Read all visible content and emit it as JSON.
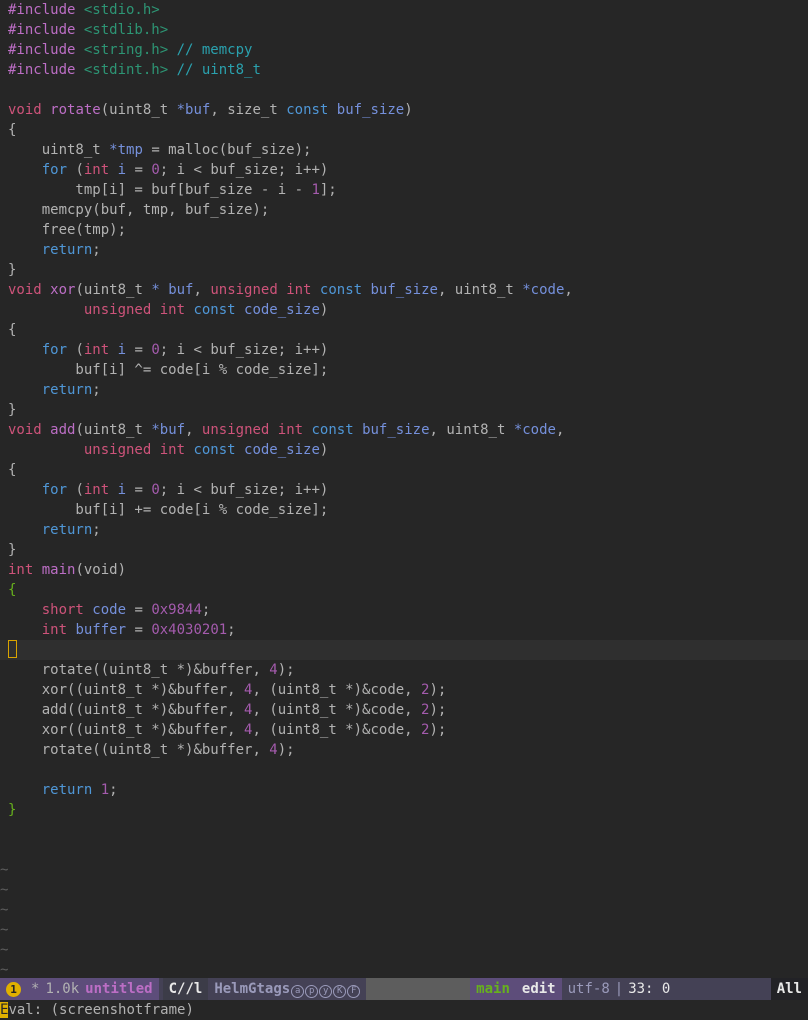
{
  "editor": {
    "code_lines": [
      [
        [
          "#include ",
          "pp"
        ],
        [
          "<stdio.h>",
          "hdr"
        ]
      ],
      [
        [
          "#include ",
          "pp"
        ],
        [
          "<stdlib.h>",
          "hdr"
        ]
      ],
      [
        [
          "#include ",
          "pp"
        ],
        [
          "<string.h>",
          "hdr"
        ],
        [
          " // memcpy",
          "cm"
        ]
      ],
      [
        [
          "#include ",
          "pp"
        ],
        [
          "<stdint.h>",
          "hdr"
        ],
        [
          " // uint8_t",
          "cm"
        ]
      ],
      [],
      [
        [
          "void ",
          "ty"
        ],
        [
          "rotate",
          "fn"
        ],
        [
          "(",
          "pl"
        ],
        [
          "uint8_t ",
          "pl"
        ],
        [
          "*",
          "ptr"
        ],
        [
          "buf",
          "var"
        ],
        [
          ", ",
          "pl"
        ],
        [
          "size_t ",
          "pl"
        ],
        [
          "const ",
          "kw"
        ],
        [
          "buf_size",
          "var"
        ],
        [
          ")",
          "pl"
        ]
      ],
      [
        [
          "{",
          "pl"
        ]
      ],
      [
        [
          "    uint8_t ",
          "pl"
        ],
        [
          "*",
          "ptr"
        ],
        [
          "tmp",
          "var"
        ],
        [
          " = malloc(buf_size);",
          "pl"
        ]
      ],
      [
        [
          "    ",
          "pl"
        ],
        [
          "for",
          "kw"
        ],
        [
          " (",
          "pl"
        ],
        [
          "int ",
          "ty"
        ],
        [
          "i",
          "var"
        ],
        [
          " = ",
          "pl"
        ],
        [
          "0",
          "num"
        ],
        [
          "; i < buf_size; i++)",
          "pl"
        ]
      ],
      [
        [
          "        tmp[i] = buf[buf_size - i - ",
          "pl"
        ],
        [
          "1",
          "num"
        ],
        [
          "];",
          "pl"
        ]
      ],
      [
        [
          "    memcpy(buf, tmp, buf_size);",
          "pl"
        ]
      ],
      [
        [
          "    free(tmp);",
          "pl"
        ]
      ],
      [
        [
          "    ",
          "pl"
        ],
        [
          "return",
          "kw"
        ],
        [
          ";",
          "pl"
        ]
      ],
      [
        [
          "}",
          "pl"
        ]
      ],
      [
        [
          "void ",
          "ty"
        ],
        [
          "xor",
          "fn"
        ],
        [
          "(",
          "pl"
        ],
        [
          "uint8_t ",
          "pl"
        ],
        [
          "* ",
          "ptr"
        ],
        [
          "buf",
          "var"
        ],
        [
          ", ",
          "pl"
        ],
        [
          "unsigned int ",
          "ty"
        ],
        [
          "const ",
          "kw"
        ],
        [
          "buf_size",
          "var"
        ],
        [
          ", uint8_t ",
          "pl"
        ],
        [
          "*",
          "ptr"
        ],
        [
          "code",
          "var"
        ],
        [
          ",",
          "pl"
        ]
      ],
      [
        [
          "         ",
          "pl"
        ],
        [
          "unsigned int ",
          "ty"
        ],
        [
          "const ",
          "kw"
        ],
        [
          "code_size",
          "var"
        ],
        [
          ")",
          "pl"
        ]
      ],
      [
        [
          "{",
          "pl"
        ]
      ],
      [
        [
          "    ",
          "pl"
        ],
        [
          "for",
          "kw"
        ],
        [
          " (",
          "pl"
        ],
        [
          "int ",
          "ty"
        ],
        [
          "i",
          "var"
        ],
        [
          " = ",
          "pl"
        ],
        [
          "0",
          "num"
        ],
        [
          "; i < buf_size; i++)",
          "pl"
        ]
      ],
      [
        [
          "        buf[i] ^= code[i % code_size];",
          "pl"
        ]
      ],
      [
        [
          "    ",
          "pl"
        ],
        [
          "return",
          "kw"
        ],
        [
          ";",
          "pl"
        ]
      ],
      [
        [
          "}",
          "pl"
        ]
      ],
      [
        [
          "void ",
          "ty"
        ],
        [
          "add",
          "fn"
        ],
        [
          "(",
          "pl"
        ],
        [
          "uint8_t ",
          "pl"
        ],
        [
          "*",
          "ptr"
        ],
        [
          "buf",
          "var"
        ],
        [
          ", ",
          "pl"
        ],
        [
          "unsigned int ",
          "ty"
        ],
        [
          "const ",
          "kw"
        ],
        [
          "buf_size",
          "var"
        ],
        [
          ", uint8_t ",
          "pl"
        ],
        [
          "*",
          "ptr"
        ],
        [
          "code",
          "var"
        ],
        [
          ",",
          "pl"
        ]
      ],
      [
        [
          "         ",
          "pl"
        ],
        [
          "unsigned int ",
          "ty"
        ],
        [
          "const ",
          "kw"
        ],
        [
          "code_size",
          "var"
        ],
        [
          ")",
          "pl"
        ]
      ],
      [
        [
          "{",
          "pl"
        ]
      ],
      [
        [
          "    ",
          "pl"
        ],
        [
          "for",
          "kw"
        ],
        [
          " (",
          "pl"
        ],
        [
          "int ",
          "ty"
        ],
        [
          "i",
          "var"
        ],
        [
          " = ",
          "pl"
        ],
        [
          "0",
          "num"
        ],
        [
          "; i < buf_size; i++)",
          "pl"
        ]
      ],
      [
        [
          "        buf[i] += code[i % code_size];",
          "pl"
        ]
      ],
      [
        [
          "    ",
          "pl"
        ],
        [
          "return",
          "kw"
        ],
        [
          ";",
          "pl"
        ]
      ],
      [
        [
          "}",
          "pl"
        ]
      ],
      [
        [
          "int ",
          "ty"
        ],
        [
          "main",
          "fn"
        ],
        [
          "(void)",
          "pl"
        ]
      ],
      [
        [
          "{",
          "brace-g"
        ]
      ],
      [
        [
          "    ",
          "pl"
        ],
        [
          "short ",
          "ty"
        ],
        [
          "code",
          "var"
        ],
        [
          " = ",
          "pl"
        ],
        [
          "0x9844",
          "num"
        ],
        [
          ";",
          "pl"
        ]
      ],
      [
        [
          "    ",
          "pl"
        ],
        [
          "int ",
          "ty"
        ],
        [
          "buffer",
          "var"
        ],
        [
          " = ",
          "pl"
        ],
        [
          "0x4030201",
          "num"
        ],
        [
          ";",
          "pl"
        ]
      ],
      [
        "CURSOR"
      ],
      [
        [
          "    rotate(",
          "pl"
        ],
        [
          "(uint8_t *)",
          "pl"
        ],
        [
          "&buffer, ",
          "pl"
        ],
        [
          "4",
          "num"
        ],
        [
          ");",
          "pl"
        ]
      ],
      [
        [
          "    xor(",
          "pl"
        ],
        [
          "(uint8_t *)",
          "pl"
        ],
        [
          "&buffer, ",
          "pl"
        ],
        [
          "4",
          "num"
        ],
        [
          ", ",
          "pl"
        ],
        [
          "(uint8_t *)",
          "pl"
        ],
        [
          "&code, ",
          "pl"
        ],
        [
          "2",
          "num"
        ],
        [
          ");",
          "pl"
        ]
      ],
      [
        [
          "    add(",
          "pl"
        ],
        [
          "(uint8_t *)",
          "pl"
        ],
        [
          "&buffer, ",
          "pl"
        ],
        [
          "4",
          "num"
        ],
        [
          ", ",
          "pl"
        ],
        [
          "(uint8_t *)",
          "pl"
        ],
        [
          "&code, ",
          "pl"
        ],
        [
          "2",
          "num"
        ],
        [
          ");",
          "pl"
        ]
      ],
      [
        [
          "    xor(",
          "pl"
        ],
        [
          "(uint8_t *)",
          "pl"
        ],
        [
          "&buffer, ",
          "pl"
        ],
        [
          "4",
          "num"
        ],
        [
          ", ",
          "pl"
        ],
        [
          "(uint8_t *)",
          "pl"
        ],
        [
          "&code, ",
          "pl"
        ],
        [
          "2",
          "num"
        ],
        [
          ");",
          "pl"
        ]
      ],
      [
        [
          "    rotate(",
          "pl"
        ],
        [
          "(uint8_t *)",
          "pl"
        ],
        [
          "&buffer, ",
          "pl"
        ],
        [
          "4",
          "num"
        ],
        [
          ");",
          "pl"
        ]
      ],
      [],
      [
        [
          "    ",
          "pl"
        ],
        [
          "return ",
          "kw"
        ],
        [
          "1",
          "num"
        ],
        [
          ";",
          "pl"
        ]
      ],
      [
        [
          "}",
          "brace-g"
        ]
      ]
    ],
    "empty_line_marker": "~",
    "empty_line_count": 6,
    "current_line_index": 32
  },
  "modeline": {
    "window_number": "1",
    "modified_flag": "*",
    "buffer_size": "1.0k",
    "buffer_name": "untitled",
    "major_mode": "C//l",
    "minor_mode": "HelmGtags",
    "minor_mode_flags": [
      "a",
      "p",
      "y",
      "K",
      "F"
    ],
    "function_name": "main",
    "evil_state": "edit",
    "encoding": "utf-8",
    "separator": "|",
    "position": "33: 0",
    "scroll": "All"
  },
  "minibuffer": {
    "cursor_char": "E",
    "prompt": "val: ",
    "expression": "(screenshotframe)"
  },
  "colors": {
    "background": "#262626",
    "current_line": "#2f2f2f",
    "cursor": "#e0b000",
    "keyword": "#4f97d7",
    "type": "#ce537a",
    "function": "#bc6ec5",
    "variable": "#7590db",
    "number": "#a45bad",
    "header": "#2d9574",
    "comment": "#2aa1ae",
    "modeline_accent": "#5d4d7a"
  }
}
